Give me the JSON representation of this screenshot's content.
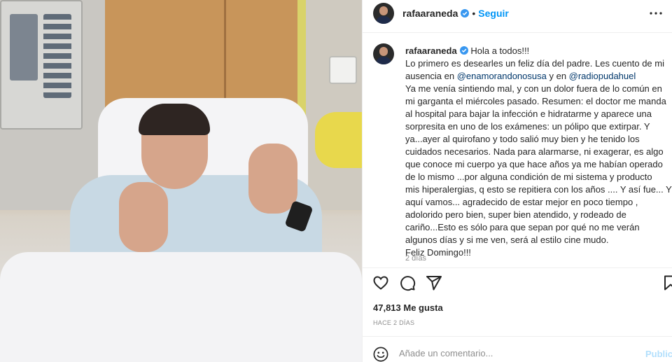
{
  "post": {
    "username": "rafaaraneda",
    "follow_label": "Seguir",
    "dot": "•",
    "caption_greeting": "Hola a todos!!!",
    "caption_lines": [
      "Lo primero es desearles un feliz día del padre. Les cuento de mi",
      "ausencia en ",
      "Ya me venía sintiendo mal, y con un dolor fuera de lo común en",
      "mi garganta el miércoles pasado. Resumen: el doctor me manda",
      "al hospital para bajar la infección e hidratarme y aparece una",
      "sorpresita en uno de los exámenes: un pólipo que extirpar. Y",
      "ya...ayer al quirofano y todo salió muy bien y he tenido los",
      "cuidados necesarios. Nada para alarmarse, ni exagerar, es algo",
      "que conoce mi cuerpo ya que hace años ya me habían operado",
      "de lo mismo ...por alguna condición de mi sistema y producto",
      "mis hiperalergias, q esto se repitiera con los años .... Y así fue... Y",
      "aquí vamos... agradecido de estar mejor en poco tiempo ,",
      "adolorido pero bien, super bien atendido, y rodeado de",
      "cariño...Esto es sólo para que sepan por qué no me verán",
      "algunos días y si me ven, será al estilo cine mudo.",
      "Feliz Domingo!!!"
    ],
    "mention_1": "@enamorandonosusa",
    "mention_join": " y en ",
    "mention_2": "@radiopudahuel",
    "time_ago": "2 días",
    "likes": "47,813 Me gusta",
    "date": "HACE 2 DÍAS",
    "comment_placeholder": "Añade un comentario...",
    "publish_label": "Publica"
  },
  "icons": {
    "verified": "verified-badge-icon",
    "more": "more-options-icon",
    "like": "heart-icon",
    "comment": "comment-bubble-icon",
    "share": "paper-plane-icon",
    "save": "bookmark-icon",
    "emoji": "smiley-icon"
  },
  "colors": {
    "link": "#0095f6",
    "mention": "#00376b",
    "muted": "#8e8e8e",
    "publish": "#b2dffc"
  }
}
